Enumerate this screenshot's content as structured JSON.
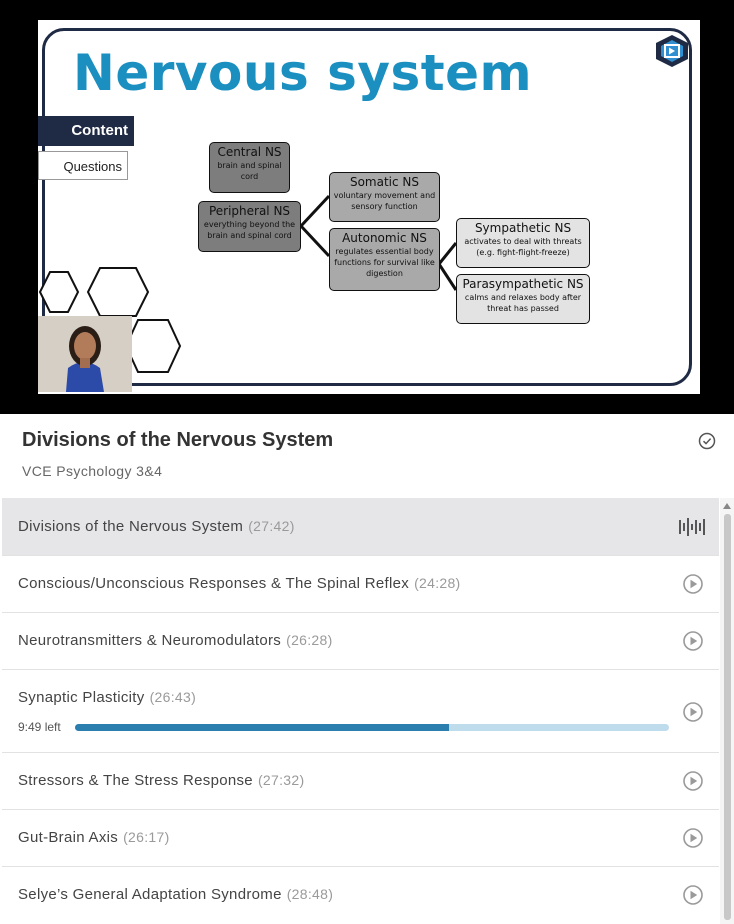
{
  "video": {
    "slide": {
      "title": "Nervous system",
      "tabs": {
        "content": "Content",
        "questions": "Questions"
      },
      "nodes": {
        "central": {
          "title": "Central NS",
          "desc": "brain and spinal cord"
        },
        "peripheral": {
          "title": "Peripheral NS",
          "desc": "everything beyond the brain and spinal cord"
        },
        "somatic": {
          "title": "Somatic NS",
          "desc": "voluntary movement and sensory function"
        },
        "autonomic": {
          "title": "Autonomic NS",
          "desc": "regulates essential body functions for survival like digestion"
        },
        "sympathetic": {
          "title": "Sympathetic NS",
          "desc": "activates to deal with threats (e.g. fight-flight-freeze)"
        },
        "parasympathetic": {
          "title": "Parasympathetic NS",
          "desc": "calms and relaxes body after threat has passed"
        }
      }
    }
  },
  "course": {
    "title": "Divisions of the Nervous System",
    "subtitle": "VCE Psychology 3&4",
    "status_icon": "check-circle-icon"
  },
  "lessons": [
    {
      "name": "Divisions of the Nervous System",
      "duration": "(27:42)",
      "state": "playing",
      "icon": "waveform-icon"
    },
    {
      "name": "Conscious/Unconscious Responses & The Spinal Reflex",
      "duration": "(24:28)",
      "icon": "play-icon"
    },
    {
      "name": "Neurotransmitters & Neuromodulators",
      "duration": "(26:28)",
      "icon": "play-icon"
    },
    {
      "name": "Synaptic Plasticity",
      "duration": "(26:43)",
      "icon": "play-icon",
      "time_left": "9:49 left",
      "progress": 0.63
    },
    {
      "name": "Stressors & The Stress Response",
      "duration": "(27:32)",
      "icon": "play-icon"
    },
    {
      "name": "Gut-Brain Axis",
      "duration": "(26:17)",
      "icon": "play-icon"
    },
    {
      "name": "Selye’s General Adaptation Syndrome",
      "duration": "(28:48)",
      "icon": "play-icon"
    }
  ],
  "colors": {
    "title_blue": "#1a8fc0",
    "navy": "#1f2a44",
    "progress_fill": "#2a7fae",
    "progress_track": "#bfdced",
    "active_row": "#e6e6e9"
  }
}
